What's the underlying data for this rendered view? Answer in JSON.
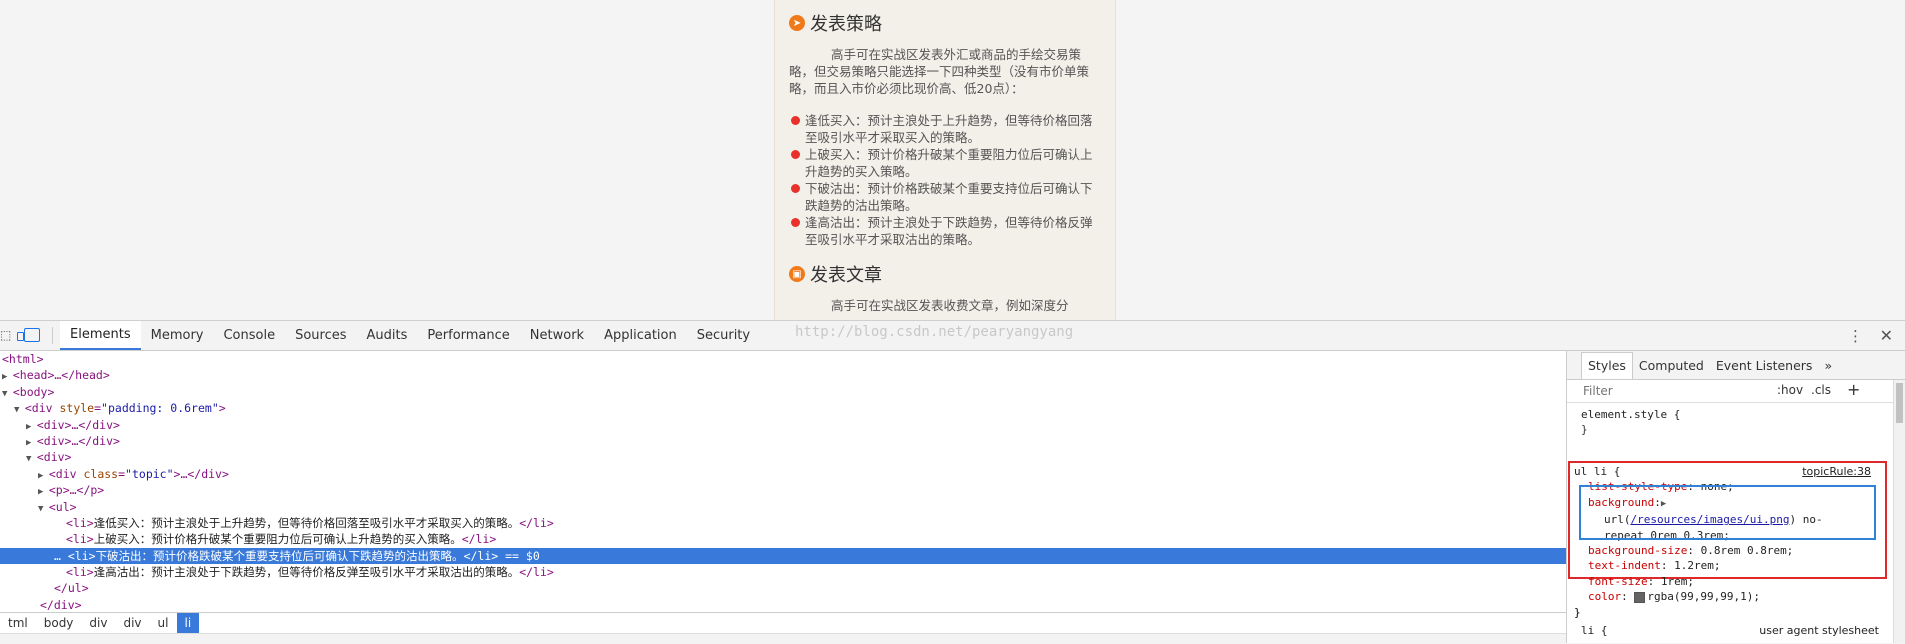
{
  "page": {
    "section1_title": "发表策略",
    "para1": "高手可在实战区发表外汇或商品的手绘交易策略，但交易策略只能选择一下四种类型（没有市价单策略，而且入市价必须比现价高、低20点）：",
    "bullets": [
      "逢低买入：预计主浪处于上升趋势，但等待价格回落至吸引水平才采取买入的策略。",
      "上破买入：预计价格升破某个重要阻力位后可确认上升趋势的买入策略。",
      "下破沽出：预计价格跌破某个重要支持位后可确认下跌趋势的沽出策略。",
      "逢高沽出：预计主浪处于下跌趋势，但等待价格反弹至吸引水平才采取沽出的策略。"
    ],
    "section2_title": "发表文章",
    "para2": "高手可在实战区发表收费文章，例如深度分",
    "accent_color": "#f07a1a",
    "bullet_color": "#e8312a"
  },
  "devtools": {
    "tabs": [
      "Elements",
      "Memory",
      "Console",
      "Sources",
      "Audits",
      "Performance",
      "Network",
      "Application",
      "Security"
    ],
    "active_tab": "Elements",
    "watermark": "http://blog.csdn.net/pearyangyang",
    "dom": {
      "html": "<html>",
      "head": "<head>…</head>",
      "body": "<body>",
      "div_open": "<div",
      "div_attr": "style",
      "div_val": "\"padding: 0.6rem\"",
      "div_collapsed": "<div>…</div>",
      "div": "<div>",
      "topic_open": "<div",
      "topic_attr": "class",
      "topic_val": "\"topic\"",
      "topic_close": ">…</div>",
      "p": "<p>…</p>",
      "ul": "<ul>",
      "li_open": "<li>",
      "li_close": "</li>",
      "li_items": [
        "逢低买入：预计主浪处于上升趋势，但等待价格回落至吸引水平才采取买入的策略。",
        "上破买入：预计价格升破某个重要阻力位后可确认上升趋势的买入策略。",
        "下破沽出：预计价格跌破某个重要支持位后可确认下跌趋势的沽出策略。",
        "逢高沽出：预计主浪处于下跌趋势，但等待价格反弹至吸引水平才采取沽出的策略。"
      ],
      "selected_marker": "== $0",
      "ul_close": "</ul>",
      "div_close": "</div>"
    },
    "breadcrumbs": [
      "tml",
      "body",
      "div",
      "div",
      "ul",
      "li"
    ],
    "active_breadcrumb": "li",
    "side_tabs": [
      "Styles",
      "Computed",
      "Event Listeners"
    ],
    "active_side_tab": "Styles",
    "filter_placeholder": "Filter",
    "hov": ":hov",
    "cls": ".cls",
    "element_style": "element.style {",
    "close_brace": "}",
    "rule": {
      "selector": "ul li {",
      "source": "topicRule:38",
      "list_style_prop": "list-style-type",
      "list_style_val": "none;",
      "background_prop": "background",
      "background_url_prefix": "url(",
      "background_url": "/resources/images/ui.png",
      "background_url_suffix": ") no-",
      "background_rest": "repeat 0rem 0.3rem;",
      "bgsize_prop": "background-size",
      "bgsize_val": "0.8rem 0.8rem;",
      "indent_prop": "text-indent",
      "indent_val": "1.2rem;",
      "fontsize_prop": "font-size",
      "fontsize_val": "1rem;",
      "color_prop": "color",
      "color_val": "rgba(99,99,99,1);"
    },
    "li_rule": "li {",
    "ua_source": "user agent stylesheet",
    "highlight_red": "#e02828",
    "highlight_blue": "#2f82d6",
    "selection_color": "#3879d9"
  }
}
